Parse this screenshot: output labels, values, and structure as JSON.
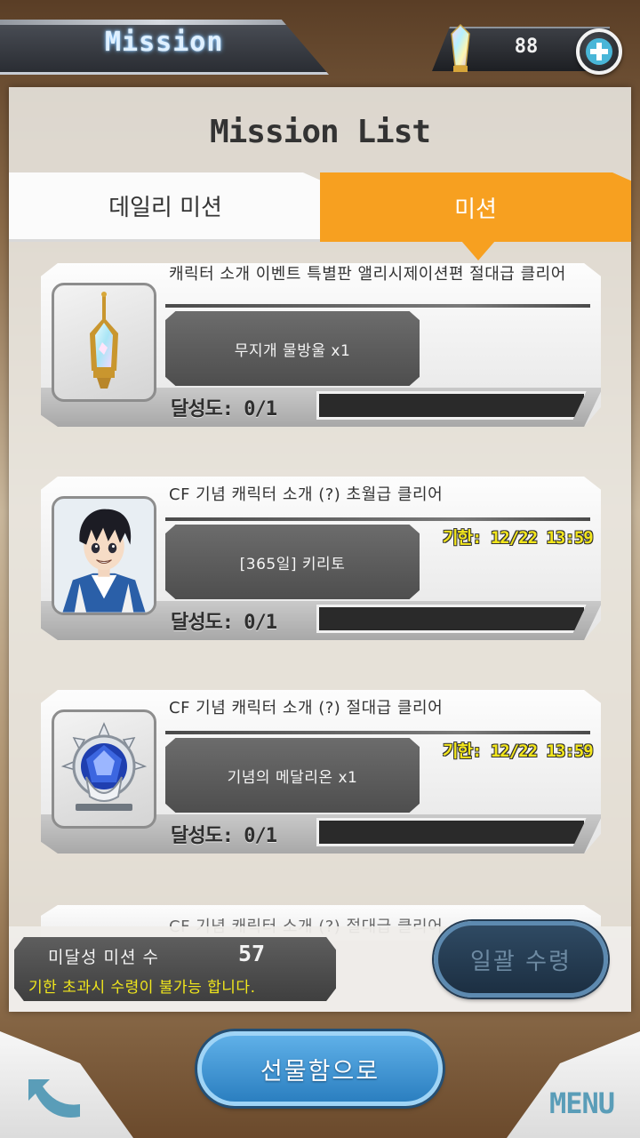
{
  "header": {
    "title": "Mission",
    "currency_value": "88",
    "currency_icon": "rainbow-crystal-icon",
    "add_icon": "plus-icon"
  },
  "panel": {
    "title": "Mission List",
    "tabs": [
      {
        "label": "데일리 미션",
        "active": false
      },
      {
        "label": "미션",
        "active": true
      }
    ]
  },
  "missions": [
    {
      "title": "캐릭터 소개 이벤트 특별판 앨리시제이션편 절대급 클리어",
      "reward": "무지개 물방울 x1",
      "icon": "rainbow-drop-lantern-icon",
      "deadline": "",
      "progress_label": "달성도: 0/1",
      "progress": 0
    },
    {
      "title": "CF 기념 캐릭터 소개 (?) 초월급 클리어",
      "reward": "[365일] 키리토",
      "icon": "kirito-portrait-icon",
      "deadline": "기한: 12/22 13:59",
      "progress_label": "달성도: 0/1",
      "progress": 0
    },
    {
      "title": "CF 기념 캐릭터 소개 (?) 절대급 클리어",
      "reward": "기념의 메달리온 x1",
      "icon": "medallion-icon",
      "deadline": "기한: 12/22 13:59",
      "progress_label": "달성도: 0/1",
      "progress": 0
    }
  ],
  "partial_mission_title": "CF 기념 캐릭터 소개 (?) 절대급 클리어",
  "footer": {
    "incomplete_label": "미달성 미션 수",
    "incomplete_count": "57",
    "warning": "기한 초과시 수령이 불가능 합니다.",
    "claim_all": "일괄 수령",
    "gift_box": "선물함으로",
    "menu": "MENU",
    "back_icon": "back-arrow-icon"
  },
  "colors": {
    "accent_orange": "#f7a020",
    "deadline_yellow": "#f3e61c",
    "button_blue": "#2b7fc0"
  }
}
